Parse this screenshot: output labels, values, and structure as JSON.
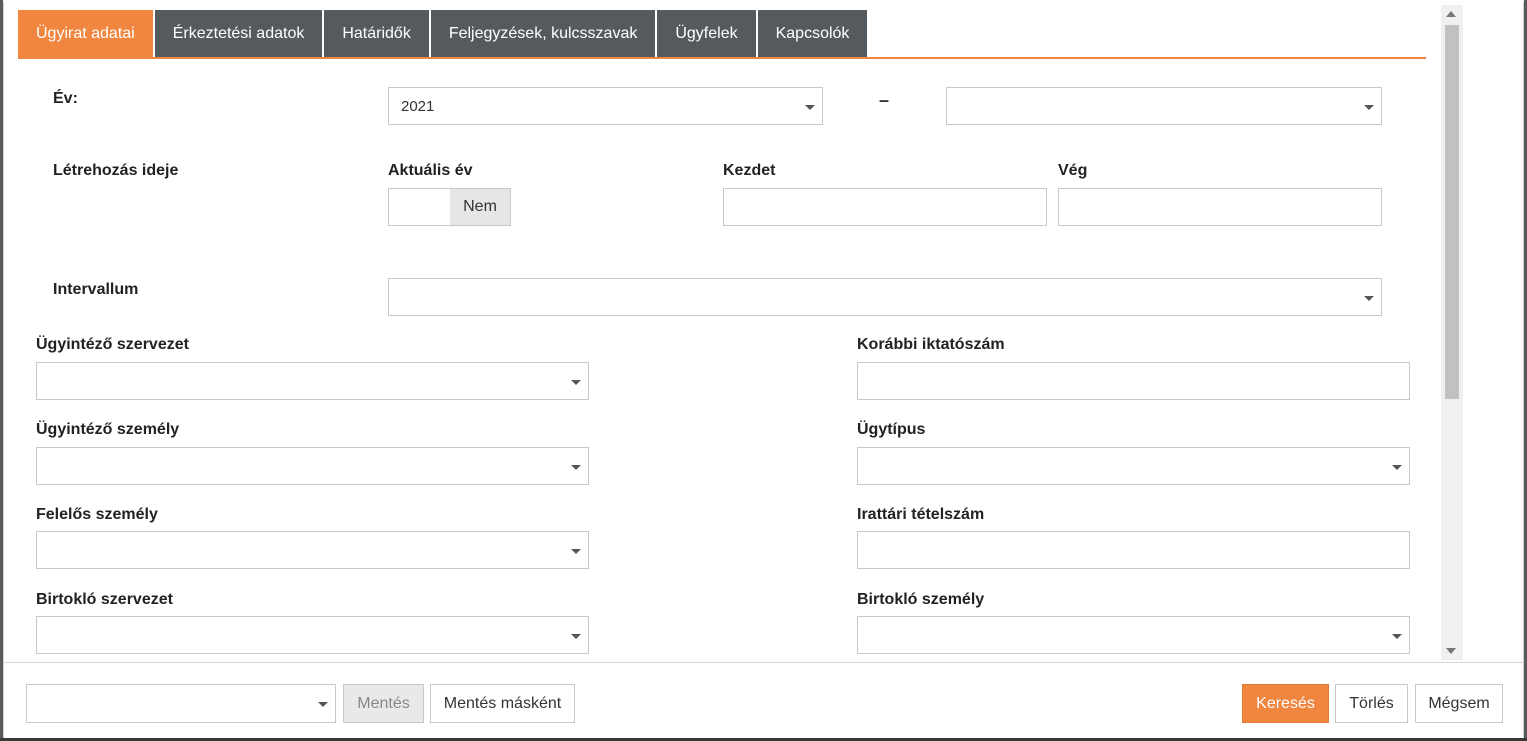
{
  "tabs": [
    {
      "label": "Ügyirat adatai",
      "active": true
    },
    {
      "label": "Érkeztetési adatok",
      "active": false
    },
    {
      "label": "Határidők",
      "active": false
    },
    {
      "label": "Feljegyzések, kulcsszavak",
      "active": false
    },
    {
      "label": "Ügyfelek",
      "active": false
    },
    {
      "label": "Kapcsolók",
      "active": false
    }
  ],
  "form": {
    "year": {
      "label": "Év:",
      "from_value": "2021",
      "separator": "–",
      "to_value": ""
    },
    "creation": {
      "label": "Létrehozás ideje",
      "current_year_label": "Aktuális év",
      "current_year_toggle": "Nem",
      "start_label": "Kezdet",
      "start_value": "",
      "end_label": "Vég",
      "end_value": ""
    },
    "interval": {
      "label": "Intervallum",
      "value": ""
    },
    "handler_org": {
      "label": "Ügyintéző szervezet",
      "value": ""
    },
    "previous_reg_number": {
      "label": "Korábbi iktatószám",
      "value": ""
    },
    "handler_person": {
      "label": "Ügyintéző személy",
      "value": ""
    },
    "case_type": {
      "label": "Ügytípus",
      "value": ""
    },
    "responsible_person": {
      "label": "Felelős személy",
      "value": ""
    },
    "archive_item_number": {
      "label": "Irattári tételszám",
      "value": ""
    },
    "holder_org": {
      "label": "Birtokló szervezet",
      "value": ""
    },
    "holder_person": {
      "label": "Birtokló személy",
      "value": ""
    }
  },
  "footer": {
    "saved_search_value": "",
    "save_label": "Mentés",
    "save_as_label": "Mentés másként",
    "search_label": "Keresés",
    "clear_label": "Törlés",
    "cancel_label": "Mégsem"
  },
  "colors": {
    "accent": "#f0863f",
    "tab_inactive": "#555a5e"
  },
  "scrollbar": {
    "scroll_fraction": 0.0
  }
}
